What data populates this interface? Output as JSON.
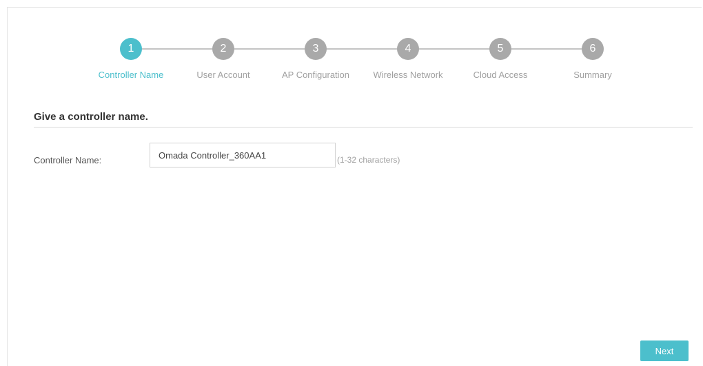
{
  "stepper": {
    "steps": [
      {
        "number": "1",
        "label": "Controller Name",
        "active": true
      },
      {
        "number": "2",
        "label": "User Account",
        "active": false
      },
      {
        "number": "3",
        "label": "AP Configuration",
        "active": false
      },
      {
        "number": "4",
        "label": "Wireless Network",
        "active": false
      },
      {
        "number": "5",
        "label": "Cloud Access",
        "active": false
      },
      {
        "number": "6",
        "label": "Summary",
        "active": false
      }
    ]
  },
  "section": {
    "title": "Give a controller name."
  },
  "form": {
    "controller_name": {
      "label": "Controller Name:",
      "value": "Omada Controller_360AA1",
      "hint": "(1-32 characters)"
    }
  },
  "actions": {
    "next_label": "Next"
  },
  "colors": {
    "accent": "#4cbfcc",
    "inactive_step": "#a9a9a9"
  }
}
